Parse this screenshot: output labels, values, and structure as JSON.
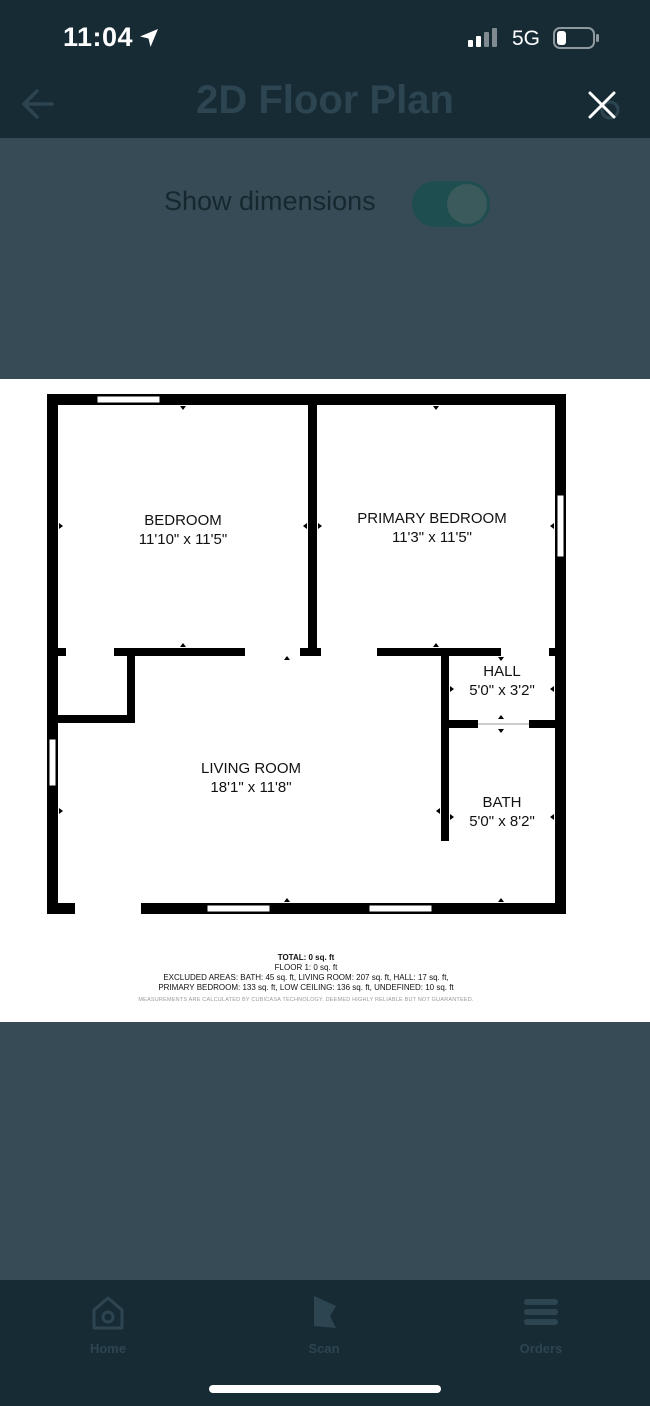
{
  "status_bar": {
    "time": "11:04",
    "network": "5G",
    "icons": [
      "location-arrow-icon",
      "signal-bars-icon",
      "battery-icon"
    ]
  },
  "header": {
    "title": "2D Floor Plan",
    "back_icon": "back-arrow-icon",
    "close_icon": "close-icon"
  },
  "settings": {
    "show_dimensions_label": "Show dimensions",
    "show_dimensions_on": true
  },
  "floor_plan": {
    "rooms": [
      {
        "name": "BEDROOM",
        "dims": "11'10\" x 11'5\""
      },
      {
        "name": "PRIMARY BEDROOM",
        "dims": "11'3\" x 11'5\""
      },
      {
        "name": "HALL",
        "dims": "5'0\" x 3'2\""
      },
      {
        "name": "LIVING ROOM",
        "dims": "18'1\" x 11'8\""
      },
      {
        "name": "BATH",
        "dims": "5'0\" x 8'2\""
      }
    ],
    "totals": {
      "total": "TOTAL: 0 sq. ft",
      "floor": "FLOOR 1: 0 sq. ft",
      "excluded_line1": "EXCLUDED AREAS: BATH: 45 sq. ft, LIVING ROOM: 207 sq. ft, HALL: 17 sq. ft,",
      "excluded_line2": "PRIMARY BEDROOM: 133 sq. ft, LOW CEILING: 136 sq. ft, UNDEFINED: 10 sq. ft",
      "disclaimer": "MEASUREMENTS ARE CALCULATED BY CUBICASA TECHNOLOGY. DEEMED HIGHLY RELIABLE BUT NOT GUARANTEED."
    }
  },
  "tabbar": {
    "tabs": [
      {
        "label": "Home",
        "icon": "home-icon"
      },
      {
        "label": "Scan",
        "icon": "scan-icon"
      },
      {
        "label": "Orders",
        "icon": "orders-icon"
      }
    ]
  },
  "colors": {
    "header_bg": "#172b35",
    "body_bg": "#364b55",
    "toggle_on": "#1f4e50",
    "wall": "#000000"
  }
}
